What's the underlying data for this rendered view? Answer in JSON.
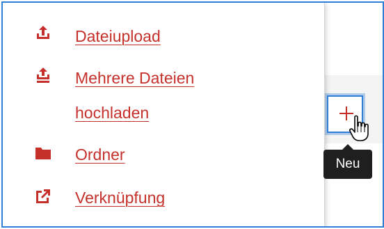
{
  "menu": {
    "items": [
      {
        "label": "Dateiupload",
        "icon": "upload-icon"
      },
      {
        "label_line1": "Mehrere Dateien",
        "label_line2": "hochladen",
        "icon": "upload-multiple-icon"
      },
      {
        "label": "Ordner",
        "icon": "folder-icon"
      },
      {
        "label": "Verknüpfung",
        "icon": "external-link-icon"
      }
    ]
  },
  "add_button": {
    "icon": "plus-icon",
    "tooltip": "Neu"
  },
  "colors": {
    "accent": "#c5302b",
    "focus": "#2f7fd6",
    "tooltip_bg": "#1f1f1f"
  }
}
